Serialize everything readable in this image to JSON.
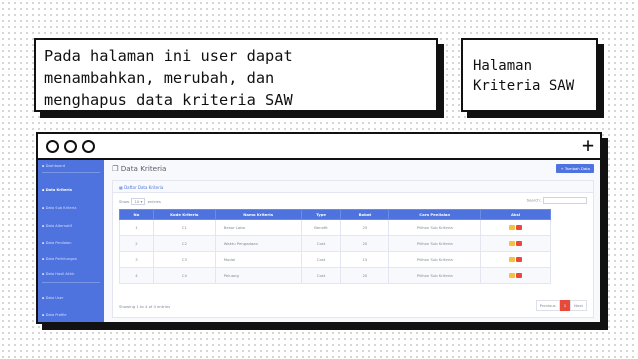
{
  "caption": {
    "lines": [
      "Pada halaman ini user dapat",
      "menambahkan, merubah, dan",
      "menghapus data kriteria SAW"
    ]
  },
  "label": {
    "lines": [
      "Halaman",
      "Kriteria SAW"
    ]
  },
  "sidebar": {
    "items": [
      {
        "label": "Dashboard",
        "active": false
      },
      {
        "label": "Data Kriteria",
        "active": true
      },
      {
        "label": "Data Sub Kriteria",
        "active": false
      },
      {
        "label": "Data Alternatif",
        "active": false
      },
      {
        "label": "Data Penilaian",
        "active": false
      },
      {
        "label": "Data Perhitungan",
        "active": false
      },
      {
        "label": "Data Hasil Akhir",
        "active": false
      },
      {
        "label": "Data User",
        "active": false
      },
      {
        "label": "Data Profile",
        "active": false
      }
    ]
  },
  "page": {
    "title": "Data Kriteria",
    "add_button": "+ Tambah Data",
    "panel_title": "Daftar Data Kriteria",
    "show_label": "Show",
    "entries_value": "10",
    "entries_label": "entries",
    "search_label": "Search:"
  },
  "table": {
    "headers": [
      "No",
      "Kode Kriteria",
      "Nama Kriteria",
      "Type",
      "Bobot",
      "Cara Penilaian",
      "Aksi"
    ],
    "rows": [
      [
        "1",
        "C1",
        "Besar Laba",
        "Benefit",
        "25",
        "Pilihan Sub Kriteria"
      ],
      [
        "2",
        "C2",
        "Waktu Pengadaan",
        "Cost",
        "20",
        "Pilihan Sub Kriteria"
      ],
      [
        "3",
        "C3",
        "Modal",
        "Cost",
        "15",
        "Pilihan Sub Kriteria"
      ],
      [
        "4",
        "C4",
        "Peluang",
        "Cost",
        "20",
        "Pilihan Sub Kriteria"
      ]
    ]
  },
  "footer": {
    "showing": "Showing 1 to 4 of 4 entries",
    "previous": "Previous",
    "current_page": "1",
    "next": "Next"
  },
  "colors": {
    "primary": "#4e73df",
    "edit": "#f6c23e",
    "delete": "#e74a3b"
  },
  "icons": [
    "plus-icon",
    "menu-icon",
    "cube-icon",
    "table-icon"
  ]
}
